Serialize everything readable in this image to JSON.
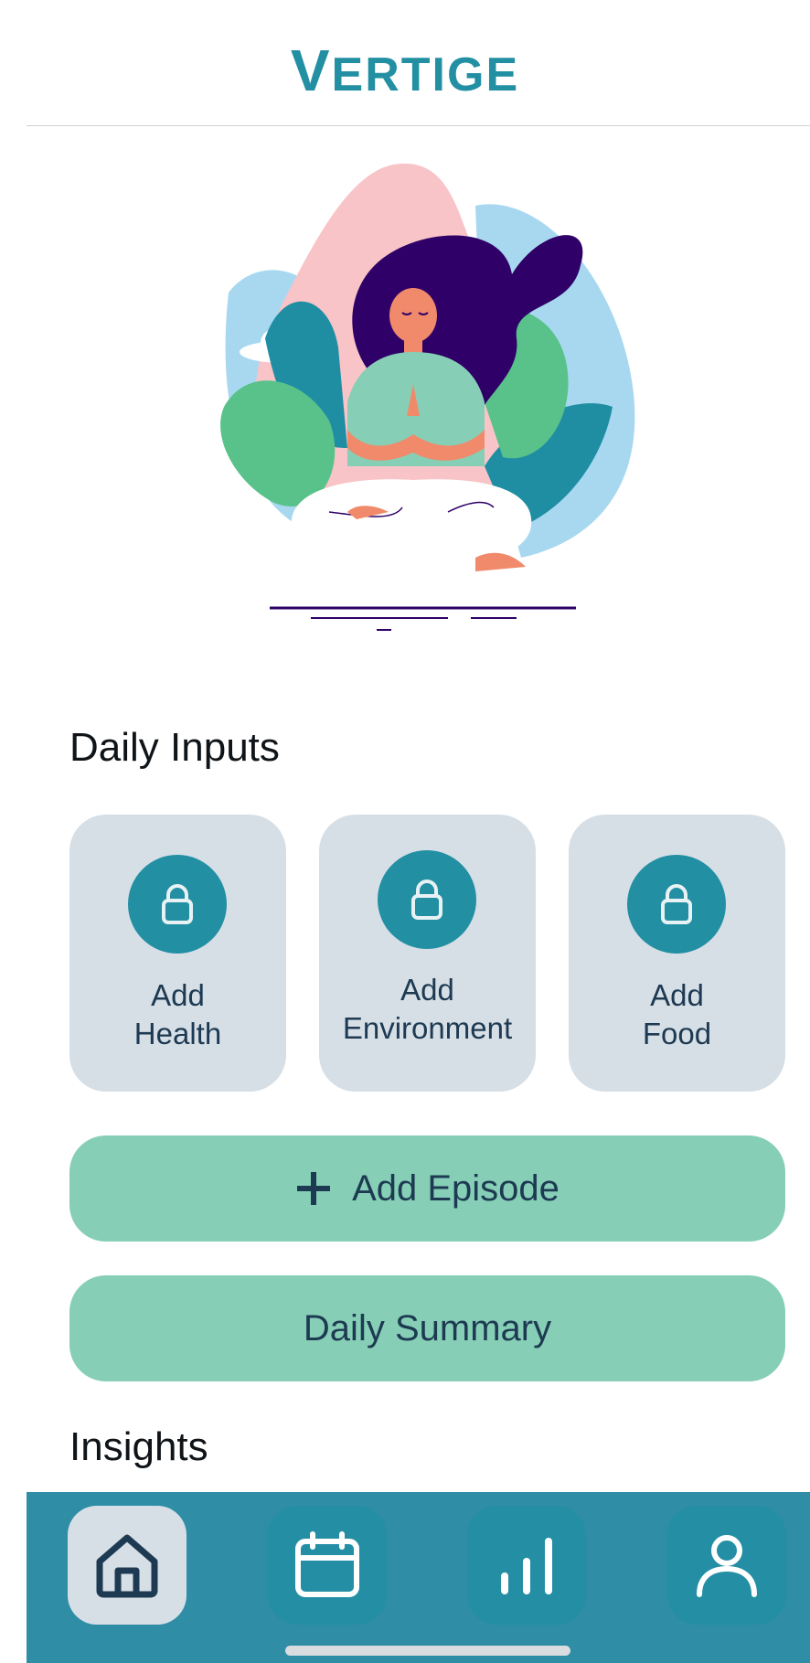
{
  "app": {
    "title": "Vertige",
    "title_initial": "V",
    "title_rest": "ERTIGE"
  },
  "sections": {
    "daily_inputs": "Daily Inputs",
    "insights": "Insights"
  },
  "cards": [
    {
      "line1": "Add",
      "line2": "Health",
      "icon": "lock-icon"
    },
    {
      "line1": "Add",
      "line2": "Environment",
      "icon": "lock-icon"
    },
    {
      "line1": "Add",
      "line2": "Food",
      "icon": "lock-icon"
    }
  ],
  "buttons": {
    "add_episode": "Add Episode",
    "daily_summary": "Daily Summary"
  },
  "tabbar": [
    {
      "icon": "home-icon",
      "active": true
    },
    {
      "icon": "calendar-icon",
      "active": false
    },
    {
      "icon": "bar-chart-icon",
      "active": false
    },
    {
      "icon": "profile-icon",
      "active": false
    }
  ],
  "colors": {
    "brand": "#228FA3",
    "card_bg": "#D6DFE6",
    "button_bg": "#86CFB6",
    "tabbar_bg": "#2F8DA5",
    "text_dark": "#1d3a52"
  }
}
